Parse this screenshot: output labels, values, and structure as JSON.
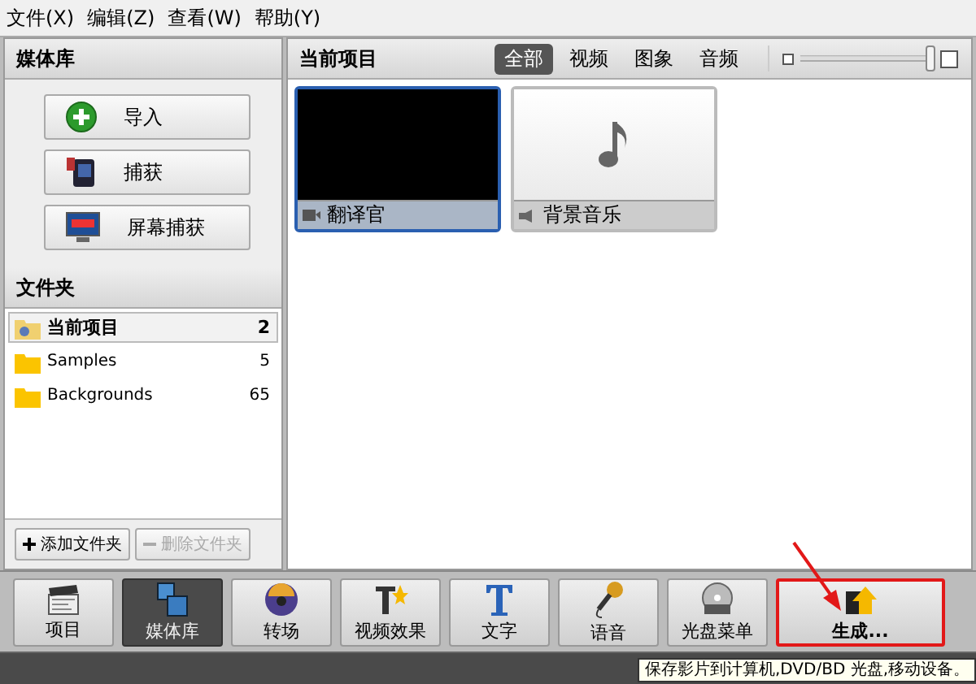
{
  "menu": [
    "文件(X)",
    "编辑(Z)",
    "查看(W)",
    "帮助(Y)"
  ],
  "library": {
    "title": "媒体库",
    "buttons": [
      {
        "label": "导入",
        "kind": "import"
      },
      {
        "label": "捕获",
        "kind": "capture"
      },
      {
        "label": "屏幕捕获",
        "kind": "screen"
      }
    ]
  },
  "folders": {
    "title": "文件夹",
    "items": [
      {
        "name": "当前项目",
        "count": "2",
        "kind": "project",
        "selected": true
      },
      {
        "name": "Samples",
        "count": "5",
        "kind": "folder",
        "selected": false
      },
      {
        "name": "Backgrounds",
        "count": "65",
        "kind": "folder",
        "selected": false
      }
    ],
    "add_button": {
      "label": "添加文件夹",
      "disabled": false
    },
    "delete_button": {
      "label": "删除文件夹",
      "disabled": true
    }
  },
  "media": {
    "title": "当前项目",
    "filters": [
      {
        "label": "全部",
        "selected": true
      },
      {
        "label": "视频",
        "selected": false
      },
      {
        "label": "图象",
        "selected": false
      },
      {
        "label": "音频",
        "selected": false
      }
    ],
    "zoom": {
      "level": 0.97
    },
    "items": [
      {
        "name": "翻译官",
        "kind": "video",
        "selected": true
      },
      {
        "name": "背景音乐",
        "kind": "audio",
        "selected": false
      }
    ]
  },
  "toolbar": [
    {
      "label": "项目",
      "kind": "project",
      "selected": false,
      "highlighted": false
    },
    {
      "label": "媒体库",
      "kind": "library",
      "selected": true,
      "highlighted": false
    },
    {
      "label": "转场",
      "kind": "transition",
      "selected": false,
      "highlighted": false
    },
    {
      "label": "视频效果",
      "kind": "effects",
      "selected": false,
      "highlighted": false
    },
    {
      "label": "文字",
      "kind": "text",
      "selected": false,
      "highlighted": false
    },
    {
      "label": "语音",
      "kind": "voice",
      "selected": false,
      "highlighted": false
    },
    {
      "label": "光盘菜单",
      "kind": "disc",
      "selected": false,
      "highlighted": false
    },
    {
      "label": "生成...",
      "kind": "produce",
      "selected": false,
      "highlighted": true
    }
  ],
  "tooltip": "保存影片到计算机,DVD/BD 光盘,移动设备。"
}
